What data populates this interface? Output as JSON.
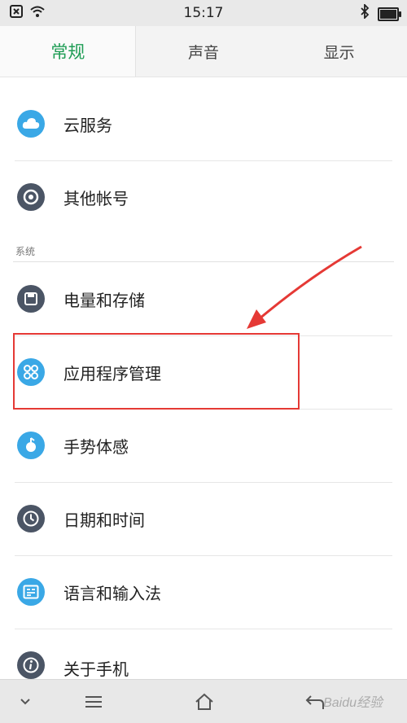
{
  "status_bar": {
    "time": "15:17",
    "icons": [
      "notification-x-icon",
      "wifi-icon",
      "bluetooth-icon",
      "battery-icon"
    ]
  },
  "tabs": [
    {
      "label": "常规",
      "active": true
    },
    {
      "label": "声音",
      "active": false
    },
    {
      "label": "显示",
      "active": false
    }
  ],
  "accent_color": "#1f9d55",
  "highlight_color": "#e53935",
  "items_top": [
    {
      "label": "云服务",
      "icon": "cloud-icon",
      "color": "#3aa8e6"
    },
    {
      "label": "其他帐号",
      "icon": "account-icon",
      "color": "#4b5565"
    }
  ],
  "section": {
    "label": "系统"
  },
  "items_system": [
    {
      "label": "电量和存储",
      "icon": "storage-icon",
      "color": "#4b5565"
    },
    {
      "label": "应用程序管理",
      "icon": "apps-icon",
      "color": "#3aa8e6"
    },
    {
      "label": "手势体感",
      "icon": "gesture-icon",
      "color": "#3aa8e6"
    },
    {
      "label": "日期和时间",
      "icon": "clock-icon",
      "color": "#4b5565"
    },
    {
      "label": "语言和输入法",
      "icon": "language-icon",
      "color": "#3aa8e6"
    },
    {
      "label": "关于手机",
      "icon": "info-icon",
      "color": "#4b5565"
    }
  ],
  "watermark": "Baidu经验"
}
